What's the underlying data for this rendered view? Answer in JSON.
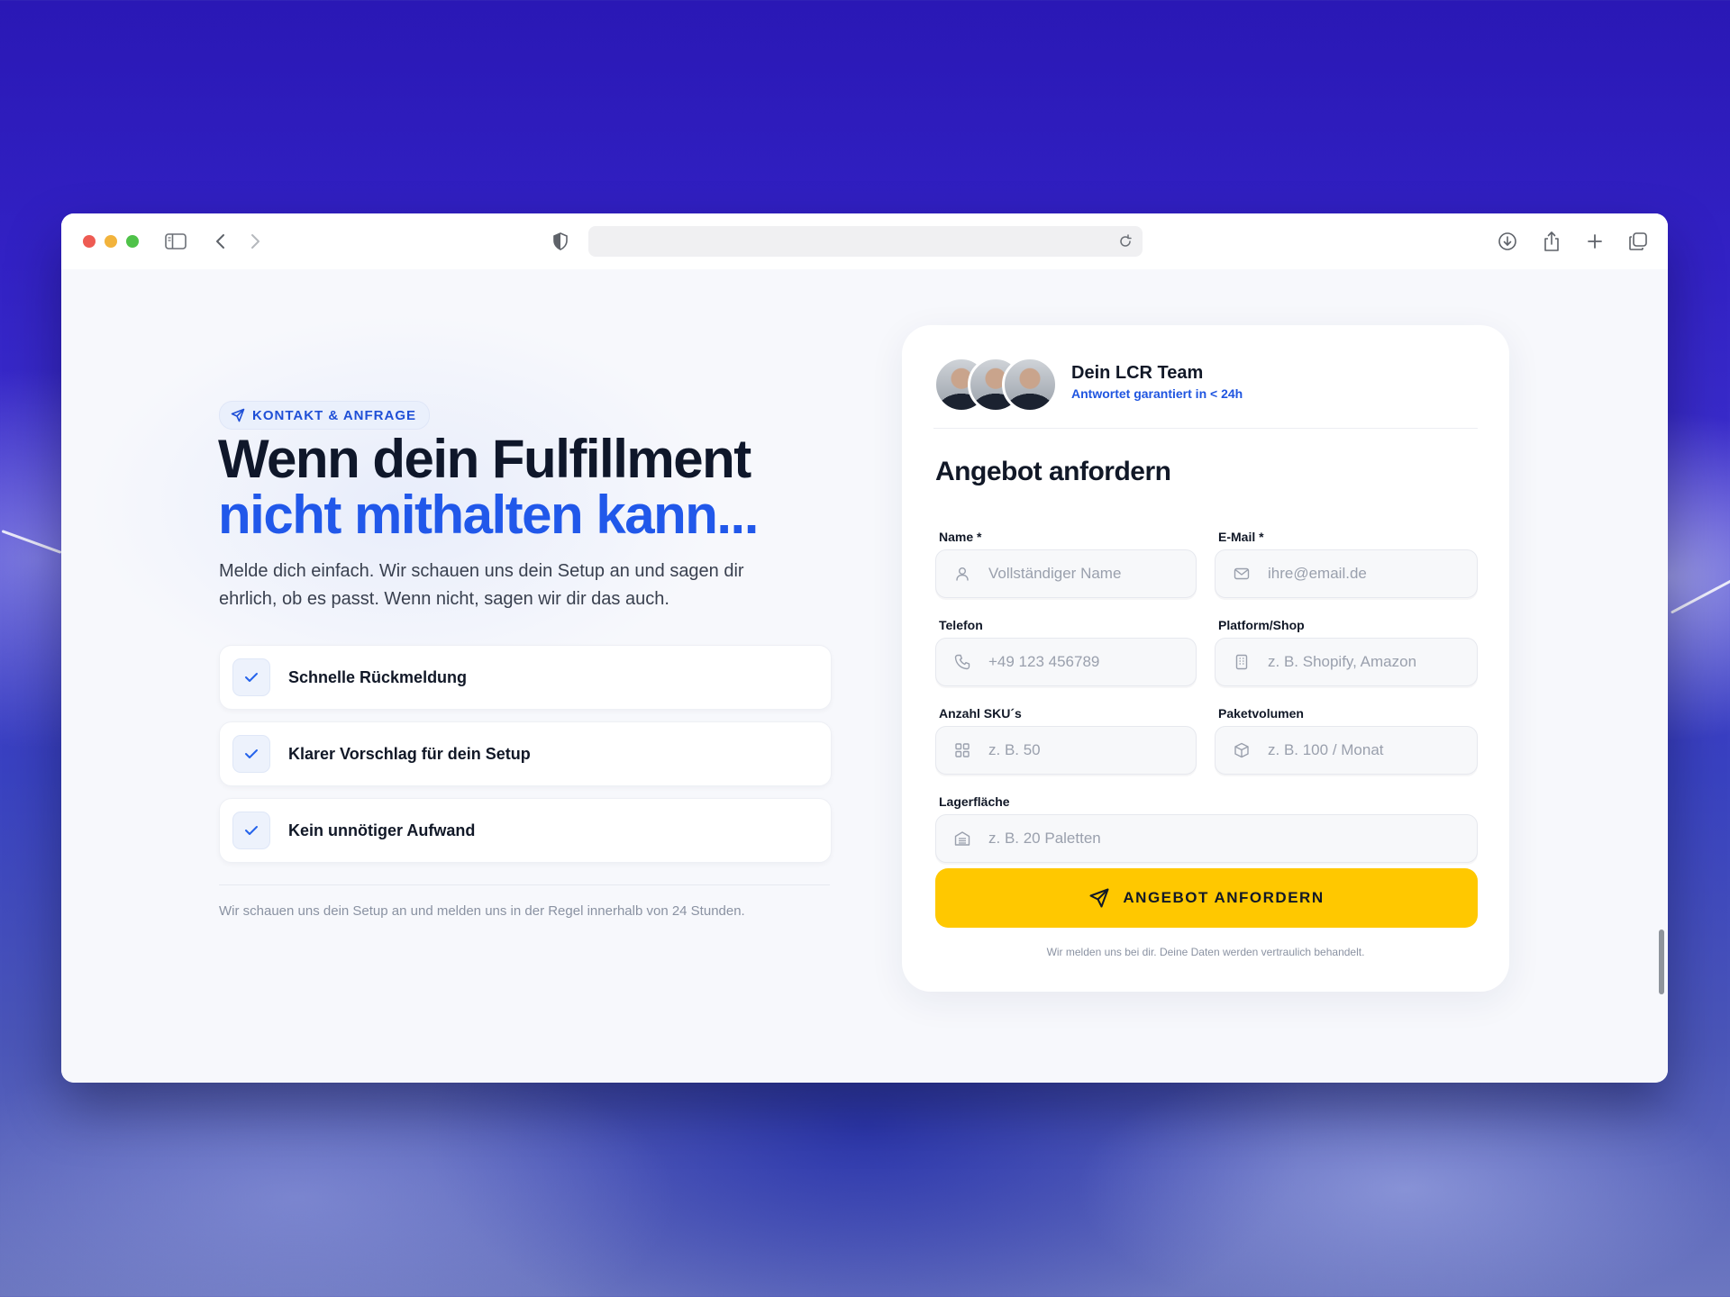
{
  "browser": {
    "address_bar": ""
  },
  "hero": {
    "badge": "KONTAKT & ANFRAGE",
    "headline_line1": "Wenn dein Fulfillment",
    "headline_line2": "nicht mithalten kann...",
    "subtext": "Melde dich einfach. Wir schauen uns dein Setup an und sagen dir ehrlich, ob es passt. Wenn nicht, sagen wir dir das auch.",
    "benefits": [
      {
        "label": "Schnelle Rückmeldung"
      },
      {
        "label": "Klarer Vorschlag für dein Setup"
      },
      {
        "label": "Kein unnötiger Aufwand"
      }
    ],
    "footnote": "Wir schauen uns dein Setup an und melden uns in der Regel innerhalb von 24 Stunden."
  },
  "card": {
    "team_name": "Dein LCR Team",
    "team_subtitle": "Antwortet garantiert in < 24h",
    "title": "Angebot anfordern",
    "fields": {
      "name": {
        "label": "Name *",
        "placeholder": "Vollständiger Name",
        "value": "",
        "icon": "user-icon"
      },
      "email": {
        "label": "E-Mail *",
        "placeholder": "ihre@email.de",
        "value": "",
        "icon": "mail-icon"
      },
      "phone": {
        "label": "Telefon",
        "placeholder": "+49 123 456789",
        "value": "",
        "icon": "phone-icon"
      },
      "platform": {
        "label": "Platform/Shop",
        "placeholder": "z. B. Shopify, Amazon",
        "value": "",
        "icon": "building-icon"
      },
      "skus": {
        "label": "Anzahl SKU´s",
        "placeholder": "z. B. 50",
        "value": "",
        "icon": "grid-icon"
      },
      "volume": {
        "label": "Paketvolumen",
        "placeholder": "z. B. 100 / Monat",
        "value": "",
        "icon": "package-icon"
      },
      "storage": {
        "label": "Lagerfläche",
        "placeholder": "z. B. 20 Paletten",
        "value": "",
        "icon": "warehouse-icon"
      }
    },
    "submit_label": "ANGEBOT ANFORDERN",
    "privacy_note": "Wir melden uns bei dir. Deine Daten werden vertraulich behandelt."
  },
  "colors": {
    "accent_blue": "#2158ea",
    "button_yellow": "#ffc800",
    "text_dark": "#111827"
  }
}
